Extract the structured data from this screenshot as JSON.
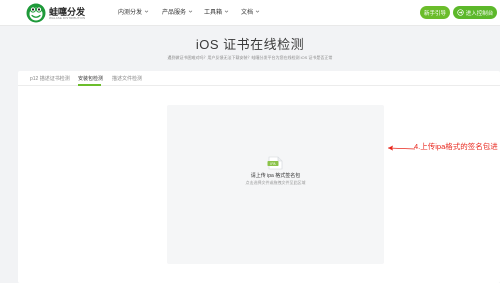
{
  "brand": {
    "name": "蛙噻分发",
    "tagline": "WALASE DISTRIBUTION",
    "accent": "#6bbd2b"
  },
  "nav": {
    "items": [
      {
        "label": "内测分发"
      },
      {
        "label": "产品服务"
      },
      {
        "label": "工具箱"
      },
      {
        "label": "文档"
      }
    ],
    "novice_label": "新手引导",
    "console_label": "进入控制台"
  },
  "hero": {
    "title": "iOS 证书在线检测",
    "subtitle": "遇到做证书困难对吗？用户反馈无法下载安装？蛙噻分发平台为您在线检测 iOS 证书是否正常"
  },
  "tabs": [
    {
      "label": "p12 描述证书检测",
      "active": false
    },
    {
      "label": "安装包检测",
      "active": true
    },
    {
      "label": "描述文件检测",
      "active": false
    }
  ],
  "upload": {
    "file_badge": "IPA",
    "main_text": "请上传 ipa 格式签名包",
    "hint_text": "点击选择文件或拖拽文件至此区域"
  },
  "annotation": {
    "text": "4.上传ipa格式的签名包进",
    "color": "#e8261c"
  }
}
